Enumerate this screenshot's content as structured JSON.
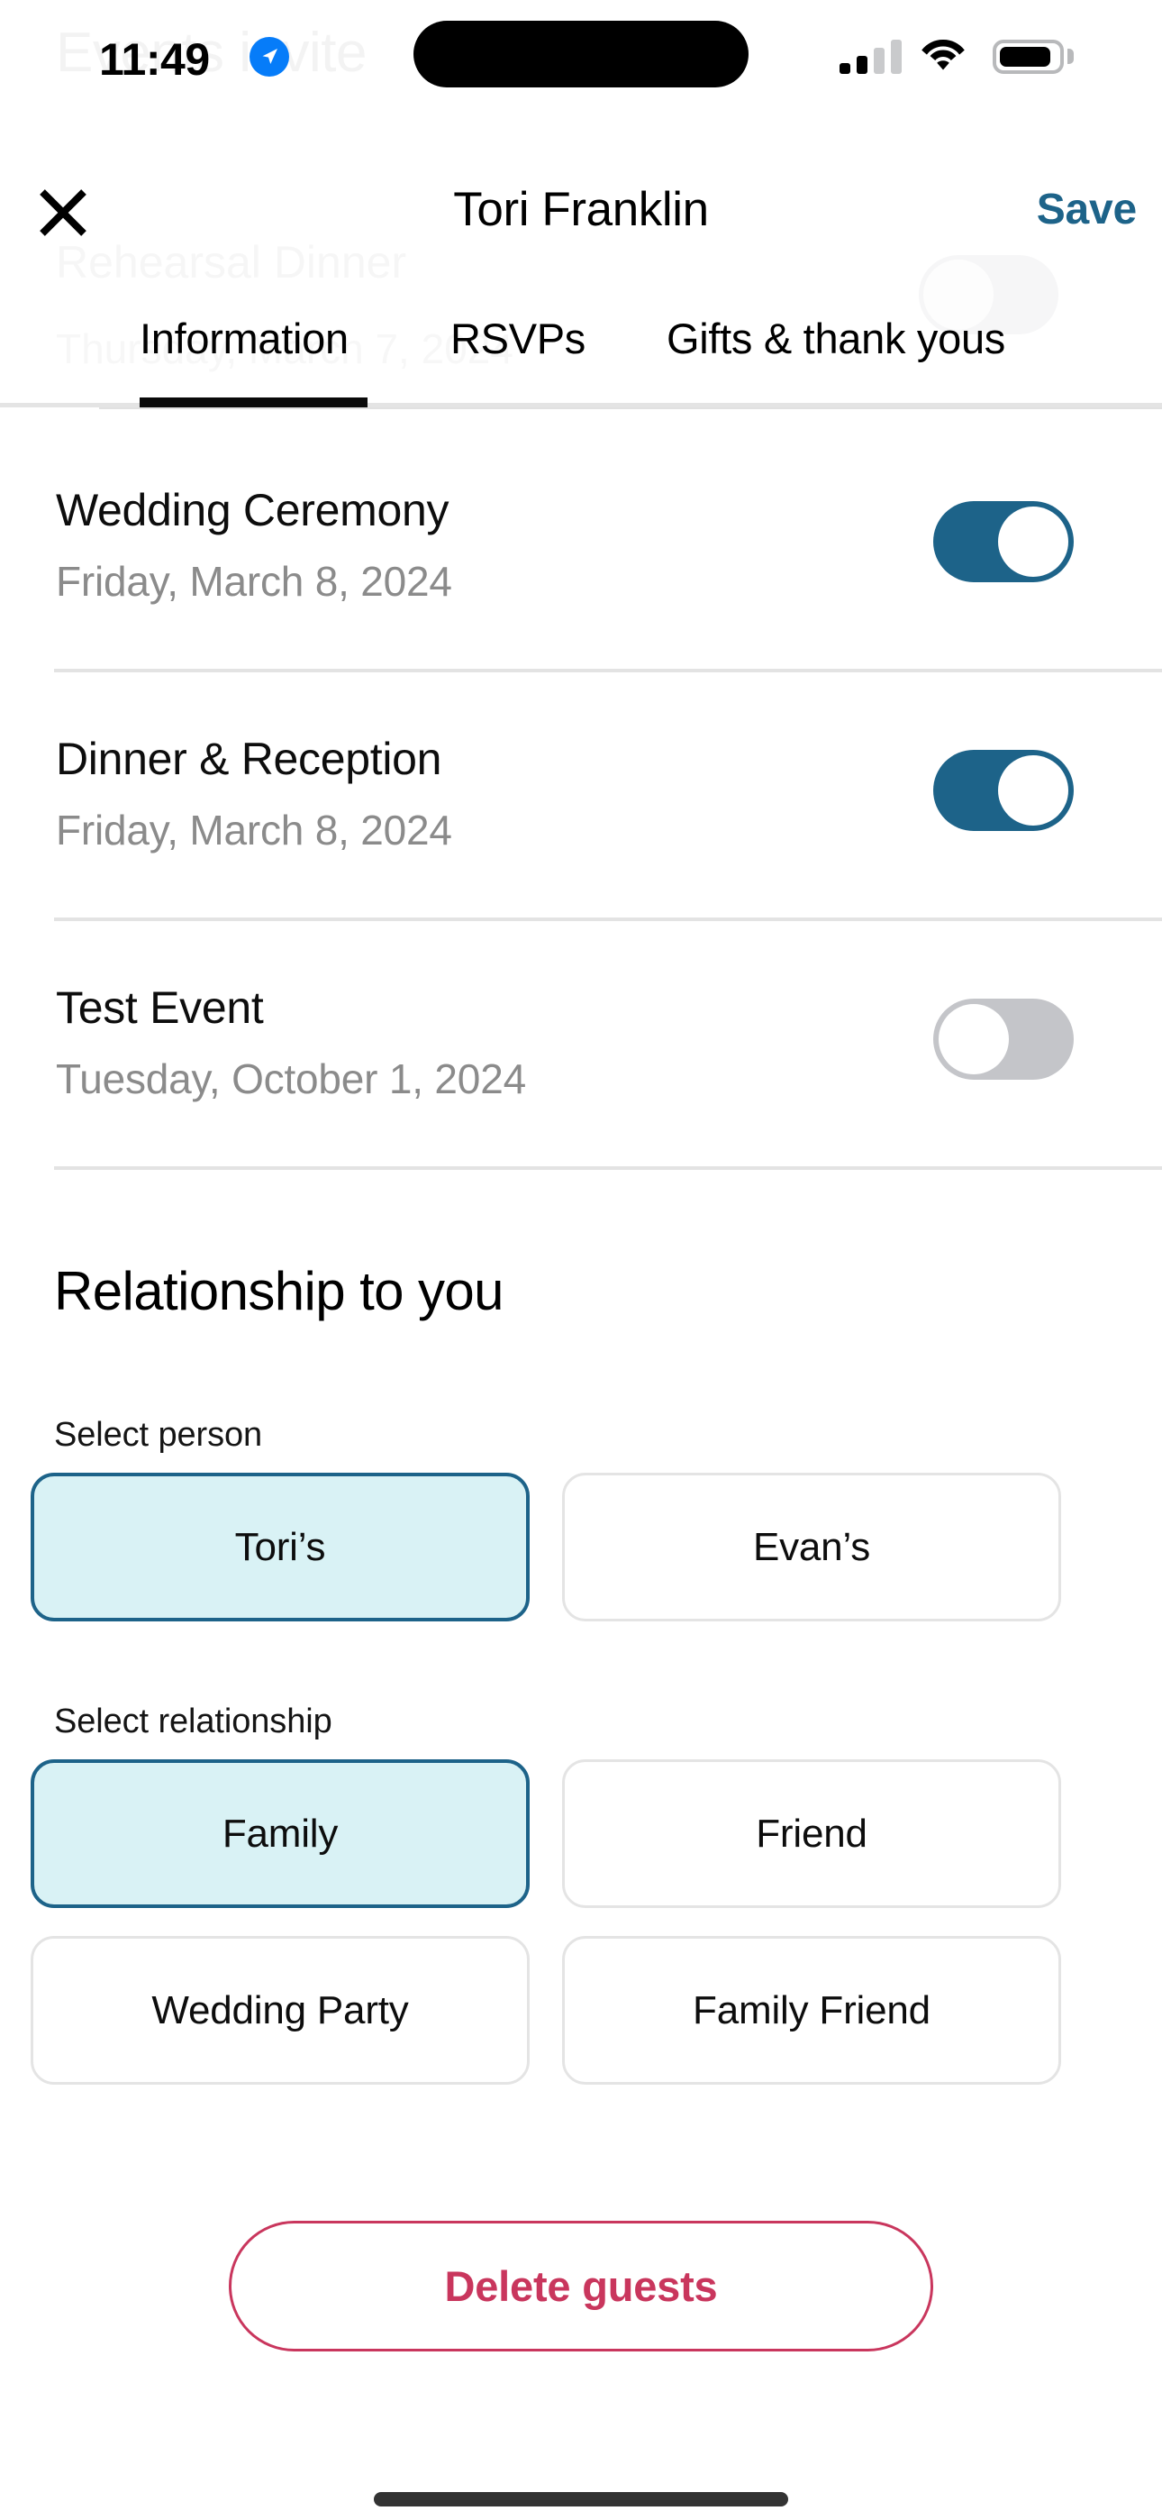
{
  "status_bar": {
    "time": "11:49",
    "location_icon": "location-arrow-icon",
    "signal_icon": "cellular-signal-icon",
    "signal_bars_filled": 2,
    "signal_bars_total": 4,
    "wifi_icon": "wifi-icon",
    "battery_icon": "battery-icon",
    "battery_level_percent": 75
  },
  "underlay": {
    "title": "Events invite",
    "event_name": "Rehearsal Dinner",
    "event_date": "Thursday, March 7, 2024"
  },
  "nav_header": {
    "close_icon": "close-x-icon",
    "title": "Tori Franklin",
    "save_label": "Save",
    "save_color": "#1d6389"
  },
  "tabs": {
    "items": [
      {
        "label": "Information",
        "active": true
      },
      {
        "label": "RSVPs",
        "active": false
      },
      {
        "label": "Gifts & thank yous",
        "active": false
      }
    ],
    "active_indicator_color": "#0a0a0a"
  },
  "events": {
    "rows": [
      {
        "name": "Wedding Ceremony",
        "date": "Friday, March 8, 2024",
        "toggle_state": "on"
      },
      {
        "name": "Dinner & Reception",
        "date": "Friday, March 8, 2024",
        "toggle_state": "on"
      },
      {
        "name": "Test Event",
        "date": "Tuesday, October 1, 2024",
        "toggle_state": "off"
      }
    ],
    "toggle_on_color": "#1d6389",
    "toggle_off_color": "#c4c5c9"
  },
  "relationship": {
    "heading": "Relationship to you",
    "person_label": "Select person",
    "person_options": [
      {
        "label": "Tori’s",
        "selected": true
      },
      {
        "label": "Evan’s",
        "selected": false
      }
    ],
    "relationship_label": "Select relationship",
    "relationship_options": [
      {
        "label": "Family",
        "selected": true
      },
      {
        "label": "Friend",
        "selected": false
      },
      {
        "label": "Wedding Party",
        "selected": false
      },
      {
        "label": "Family Friend",
        "selected": false
      }
    ],
    "selected_fill": "#d9f2f5",
    "selected_border": "#1d6389"
  },
  "delete": {
    "label": "Delete guests",
    "color": "#c9365d"
  },
  "home_indicator": "home-indicator"
}
